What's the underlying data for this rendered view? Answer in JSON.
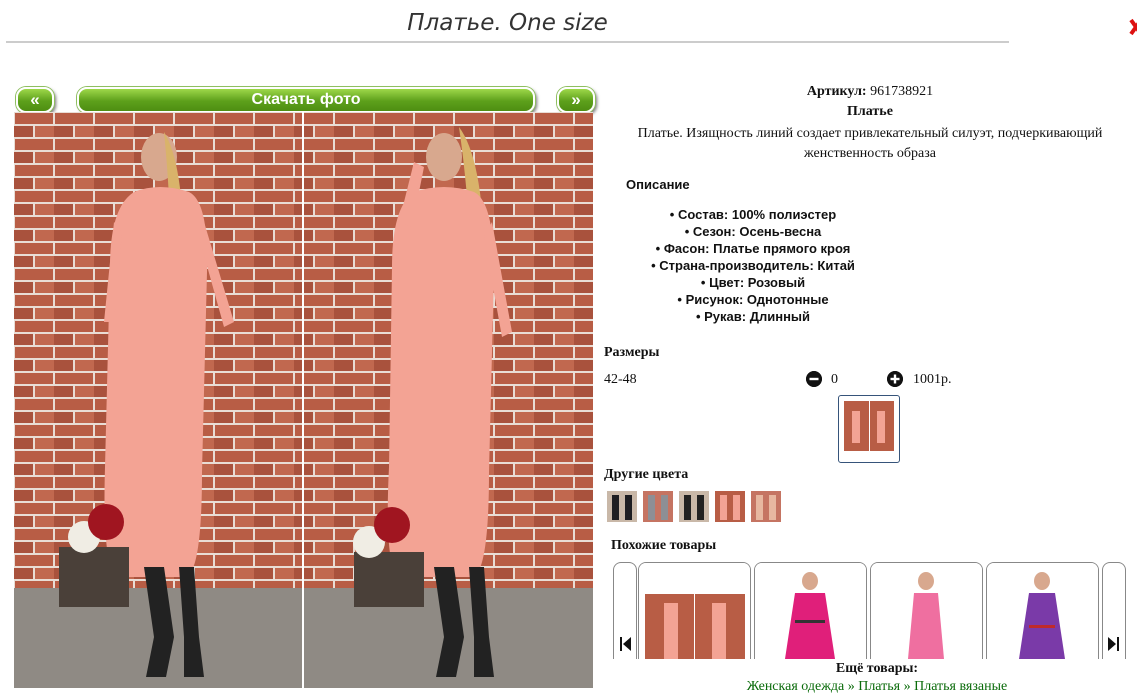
{
  "page": {
    "title": "Платье. One size"
  },
  "gallery": {
    "prev_label": "«",
    "download_label": "Скачать фото",
    "next_label": "»"
  },
  "product": {
    "article_label": "Артикул:",
    "article_value": "961738921",
    "name": "Платье",
    "description": "Платье. Изящность линий создает привлекательный силуэт, подчеркивающий женственность образа"
  },
  "details": {
    "heading": "Описание",
    "items": [
      "Состав: 100% полиэстер",
      "Сезон: Осень-весна",
      "Фасон: Платье прямого кроя",
      "Страна-производитель: Китай",
      "Цвет: Розовый",
      "Рисунок: Однотонные",
      "Рукав: Длинный"
    ]
  },
  "sizes": {
    "heading": "Размеры",
    "rows": [
      {
        "size": "42-48",
        "quantity": "0",
        "price": "1001р."
      }
    ]
  },
  "colors": {
    "heading": "Другие цвета",
    "count": 5
  },
  "similar": {
    "heading": "Похожие товары"
  },
  "more": {
    "heading": "Ещё товары:",
    "breadcrumb": "Женская одежда » Платья » Платья вязаные"
  },
  "icons": {
    "minus": "minus-circle-icon",
    "plus": "plus-circle-icon",
    "prev": "skip-back-icon",
    "next": "skip-forward-icon"
  },
  "colors_palette": {
    "accent_green": "#5da01b",
    "dress_pink": "#f2a192",
    "brick": "#b55a43",
    "link_green": "#0a6b0a"
  }
}
